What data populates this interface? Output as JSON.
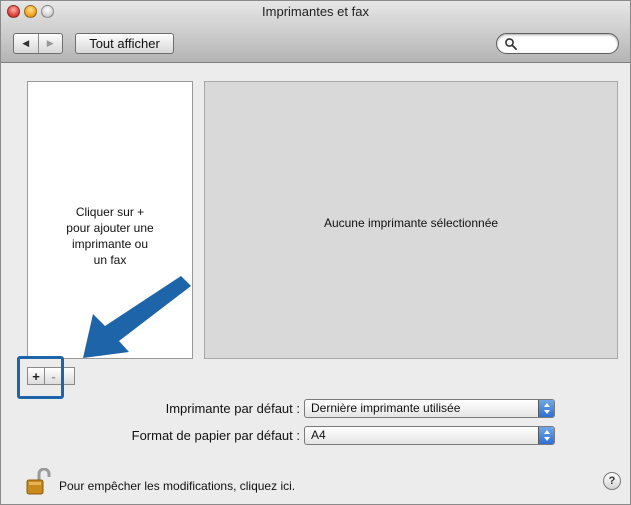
{
  "window": {
    "title": "Imprimantes et fax"
  },
  "toolbar": {
    "back_icon": "◀",
    "forward_icon": "▶",
    "show_all_label": "Tout afficher",
    "search_value": ""
  },
  "printer_list": {
    "hint_lines": [
      "Cliquer sur +",
      "pour ajouter une",
      "imprimante ou",
      "un fax"
    ],
    "add_label": "+",
    "remove_label": "-"
  },
  "detail": {
    "message": "Aucune imprimante sélectionnée"
  },
  "form": {
    "default_printer_label": "Imprimante par défaut :",
    "default_printer_value": "Dernière imprimante utilisée",
    "default_paper_label": "Format de papier par défaut :",
    "default_paper_value": "A4"
  },
  "footer": {
    "lock_text": "Pour empêcher les modifications, cliquez ici.",
    "help_label": "?"
  },
  "colors": {
    "accent_blue": "#1e64a8",
    "popup_blue": "#2f6fcf"
  }
}
